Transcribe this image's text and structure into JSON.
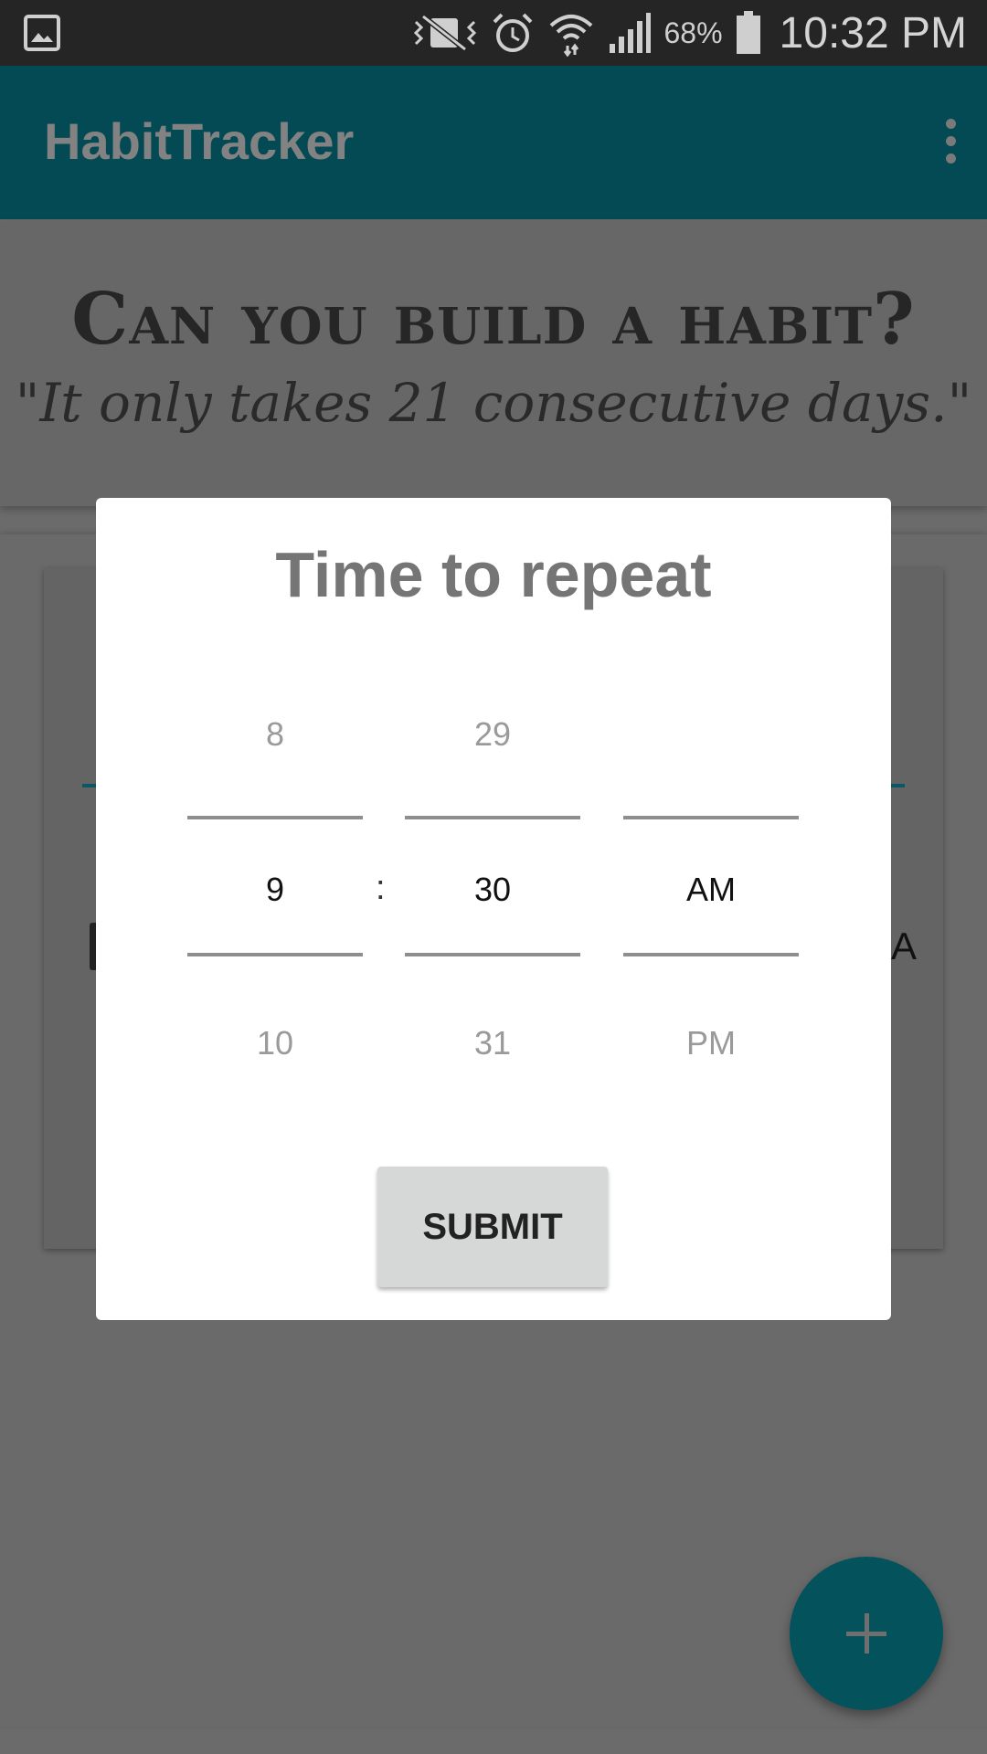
{
  "status_bar": {
    "battery_percent": "68%",
    "time": "10:32 PM",
    "icons": [
      "gallery-icon",
      "vibrate-mute-icon",
      "alarm-icon",
      "wifi-icon",
      "signal-icon",
      "battery-icon"
    ]
  },
  "app_bar": {
    "title": "HabitTracker",
    "menu_icon": "more-vert-icon"
  },
  "header": {
    "headline": "Can you build a habit?",
    "quote": "\"It only takes 21 consecutive days.\""
  },
  "background": {
    "peek_letter": "A"
  },
  "dialog": {
    "title": "Time to repeat",
    "hour": {
      "prev": "8",
      "selected": "9",
      "next": "10"
    },
    "separator": ":",
    "minute": {
      "prev": "29",
      "selected": "30",
      "next": "31"
    },
    "ampm": {
      "prev": "",
      "selected": "AM",
      "next": "PM"
    },
    "submit_label": "SUBMIT"
  },
  "fab": {
    "icon": "plus-icon"
  },
  "colors": {
    "primary": "#044a55",
    "fab": "#04525c",
    "scrim_background": "#6b6b6b",
    "dialog_background": "#ffffff"
  }
}
